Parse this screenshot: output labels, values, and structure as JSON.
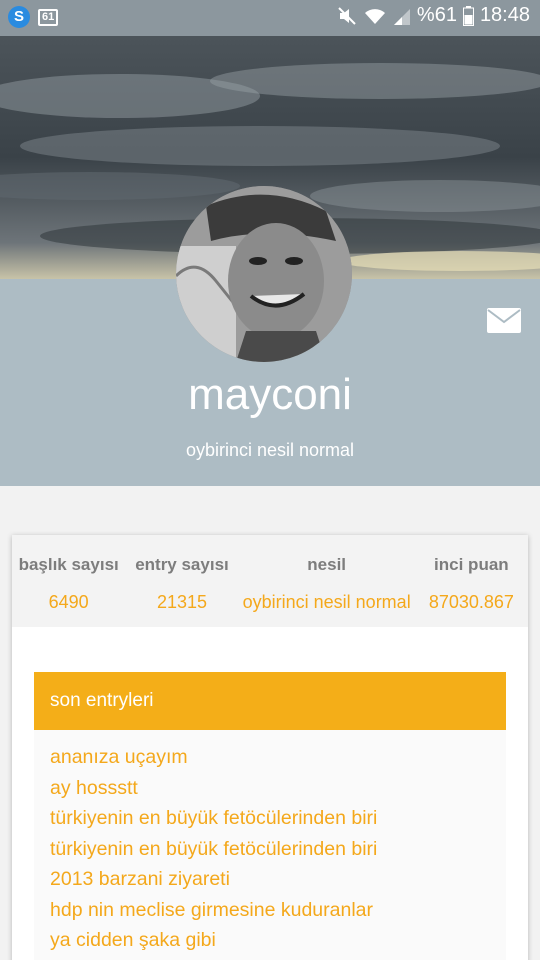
{
  "status_bar": {
    "notification_badge": "61",
    "battery_text": "%61",
    "time": "18:48",
    "icons": [
      "s-app-icon",
      "notification-count-icon",
      "mute-icon",
      "wifi-icon",
      "signal-icon",
      "battery-icon"
    ]
  },
  "profile": {
    "username": "mayconi",
    "generation": "oybirinci nesil normal",
    "message_icon": "mail-icon"
  },
  "stats": [
    {
      "label": "başlık sayısı",
      "value": "6490"
    },
    {
      "label": "entry sayısı",
      "value": "21315"
    },
    {
      "label": "nesil",
      "value": "oybirinci nesil normal"
    },
    {
      "label": "inci puan",
      "value": "87030.867"
    }
  ],
  "recent_entries": {
    "title": "son entryleri",
    "items": [
      "ananıza uçayım",
      "ay hossstt",
      "türkiyenin en büyük fetöcülerinden biri",
      "türkiyenin en büyük fetöcülerinden biri",
      "2013 barzani ziyareti",
      "hdp nin meclise girmesine kuduranlar",
      "ya cidden şaka gibi"
    ]
  },
  "colors": {
    "accent": "#f4ae18",
    "band": "#adbcc4",
    "status_bar": "#8c979e"
  }
}
